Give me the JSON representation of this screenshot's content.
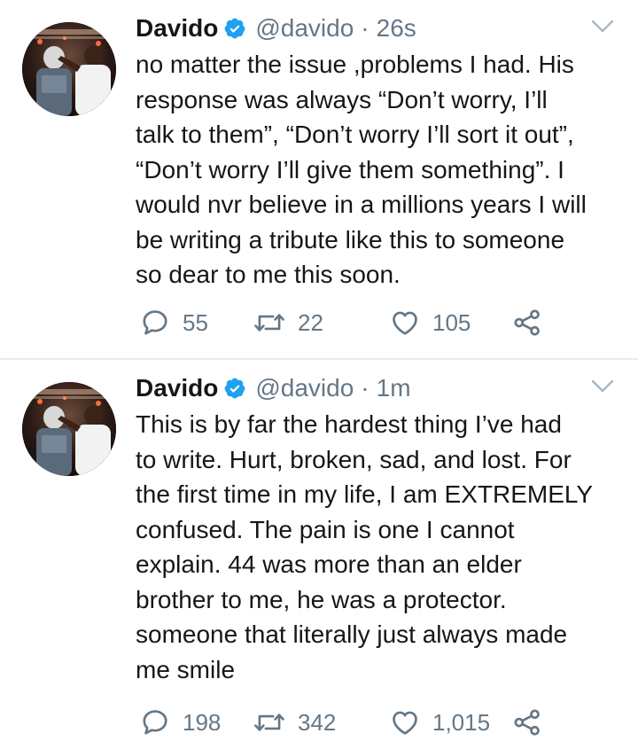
{
  "tweets": [
    {
      "author_name": "Davido",
      "handle": "@davido",
      "separator": "·",
      "time": "26s",
      "text_lines": [
        "no matter the issue ,problems I had. His",
        "response was always “Don’t worry, I’ll",
        "talk to them”, “Don’t worry I’ll sort it out”,",
        "“Don’t worry I’ll give them something”. I",
        "would nvr believe in a millions years I will",
        "be writing a tribute like this to someone",
        "so dear to me this soon."
      ],
      "replies": "55",
      "retweets": "22",
      "likes": "105"
    },
    {
      "author_name": "Davido",
      "handle": "@davido",
      "separator": "·",
      "time": "1m",
      "text_lines": [
        "This is by far the hardest thing I’ve had",
        "to write. Hurt, broken, sad, and lost. For",
        "the first time in my life, I am EXTREMELY",
        "confused. The pain is one I cannot",
        "explain. 44 was more than an elder",
        "brother to me, he was a protector.",
        "someone that literally just always made",
        "me smile"
      ],
      "replies": "198",
      "retweets": "342",
      "likes": "1,015"
    }
  ],
  "icons": {
    "verified": "verified-badge-icon",
    "caret": "chevron-down-icon",
    "reply": "reply-icon",
    "retweet": "retweet-icon",
    "like": "heart-icon",
    "share": "share-icon"
  },
  "colors": {
    "text": "#14171a",
    "muted": "#657786",
    "verified": "#1da1f2",
    "divider": "#e6ecf0"
  }
}
